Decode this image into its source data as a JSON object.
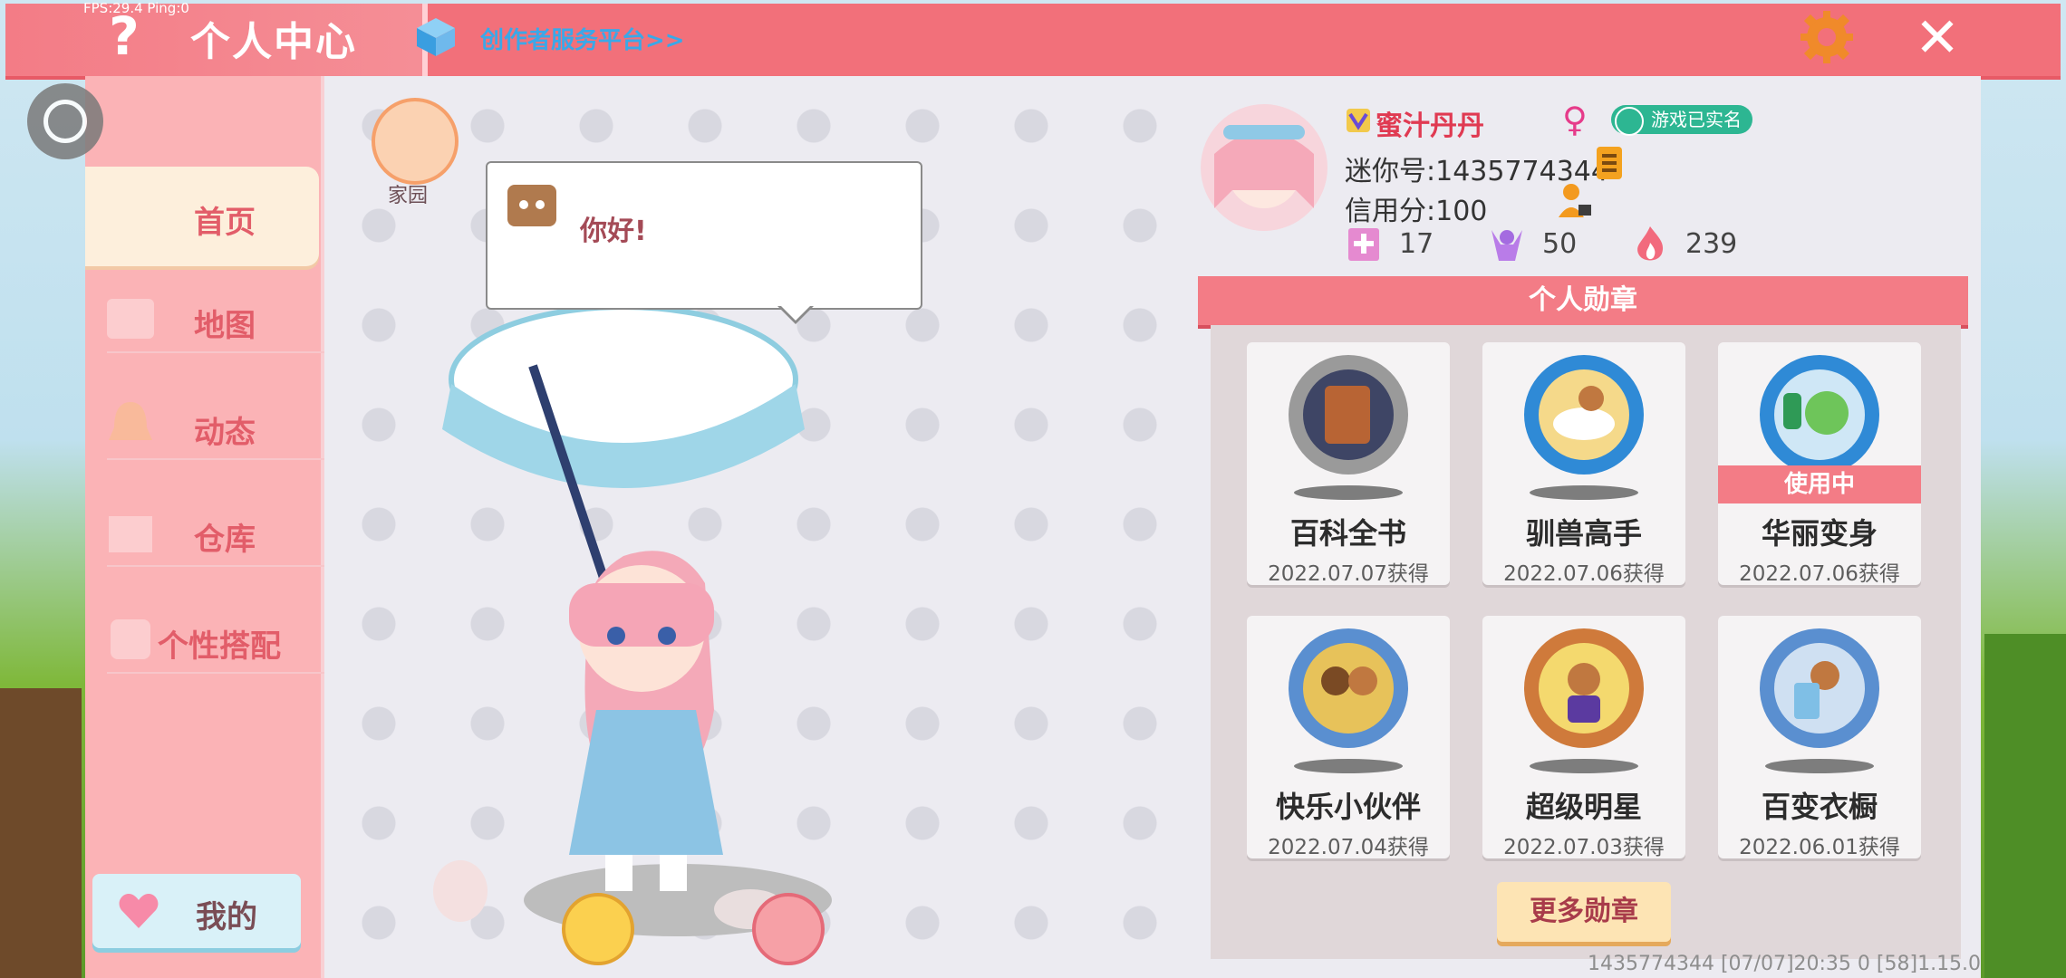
{
  "topbar": {
    "fps": "FPS:29.4  Ping:0",
    "title": "个人中心",
    "creator_link": "创作者服务平台>>",
    "help_icon": "question-mark-icon",
    "settings_icon": "gear-icon",
    "close_icon": "close-icon"
  },
  "sidebar": {
    "items": [
      {
        "label": "首页",
        "icon": "home-icon",
        "active": true
      },
      {
        "label": "地图",
        "icon": "map-icon",
        "active": false
      },
      {
        "label": "动态",
        "icon": "bell-icon",
        "active": false
      },
      {
        "label": "仓库",
        "icon": "warehouse-icon",
        "active": false
      },
      {
        "label": "个性搭配",
        "icon": "outfit-icon",
        "active": false
      }
    ],
    "my_button": "我的"
  },
  "center": {
    "home_label": "家园",
    "greeting": "你好!"
  },
  "profile": {
    "username": "蜜汁丹丹",
    "gender_symbol": "♀",
    "verified_label": "游戏已实名",
    "mini_id": "迷你号:1435774344",
    "credit": "信用分:100",
    "stats": [
      {
        "icon": "plus-flag-icon",
        "value": "17"
      },
      {
        "icon": "cheer-icon",
        "value": "50"
      },
      {
        "icon": "flame-icon",
        "value": "239"
      }
    ]
  },
  "badges": {
    "header": "个人勋章",
    "items": [
      {
        "name": "百科全书",
        "date": "2022.07.07获得",
        "in_use": false,
        "ring_color": "#9a9a9a"
      },
      {
        "name": "驯兽高手",
        "date": "2022.07.06获得",
        "in_use": false,
        "ring_color": "#2f8ad6"
      },
      {
        "name": "华丽变身",
        "date": "2022.07.06获得",
        "in_use": true,
        "ring_color": "#2f8ad6"
      },
      {
        "name": "快乐小伙伴",
        "date": "2022.07.04获得",
        "in_use": false,
        "ring_color": "#5a8fd0"
      },
      {
        "name": "超级明星",
        "date": "2022.07.03获得",
        "in_use": false,
        "ring_color": "#cf7a3b"
      },
      {
        "name": "百变衣橱",
        "date": "2022.06.01获得",
        "in_use": false,
        "ring_color": "#5a8fd0"
      }
    ],
    "in_use_label": "使用中",
    "more_button": "更多勋章"
  },
  "footer": "1435774344    [07/07]20:35 0   [58]1.15.0"
}
